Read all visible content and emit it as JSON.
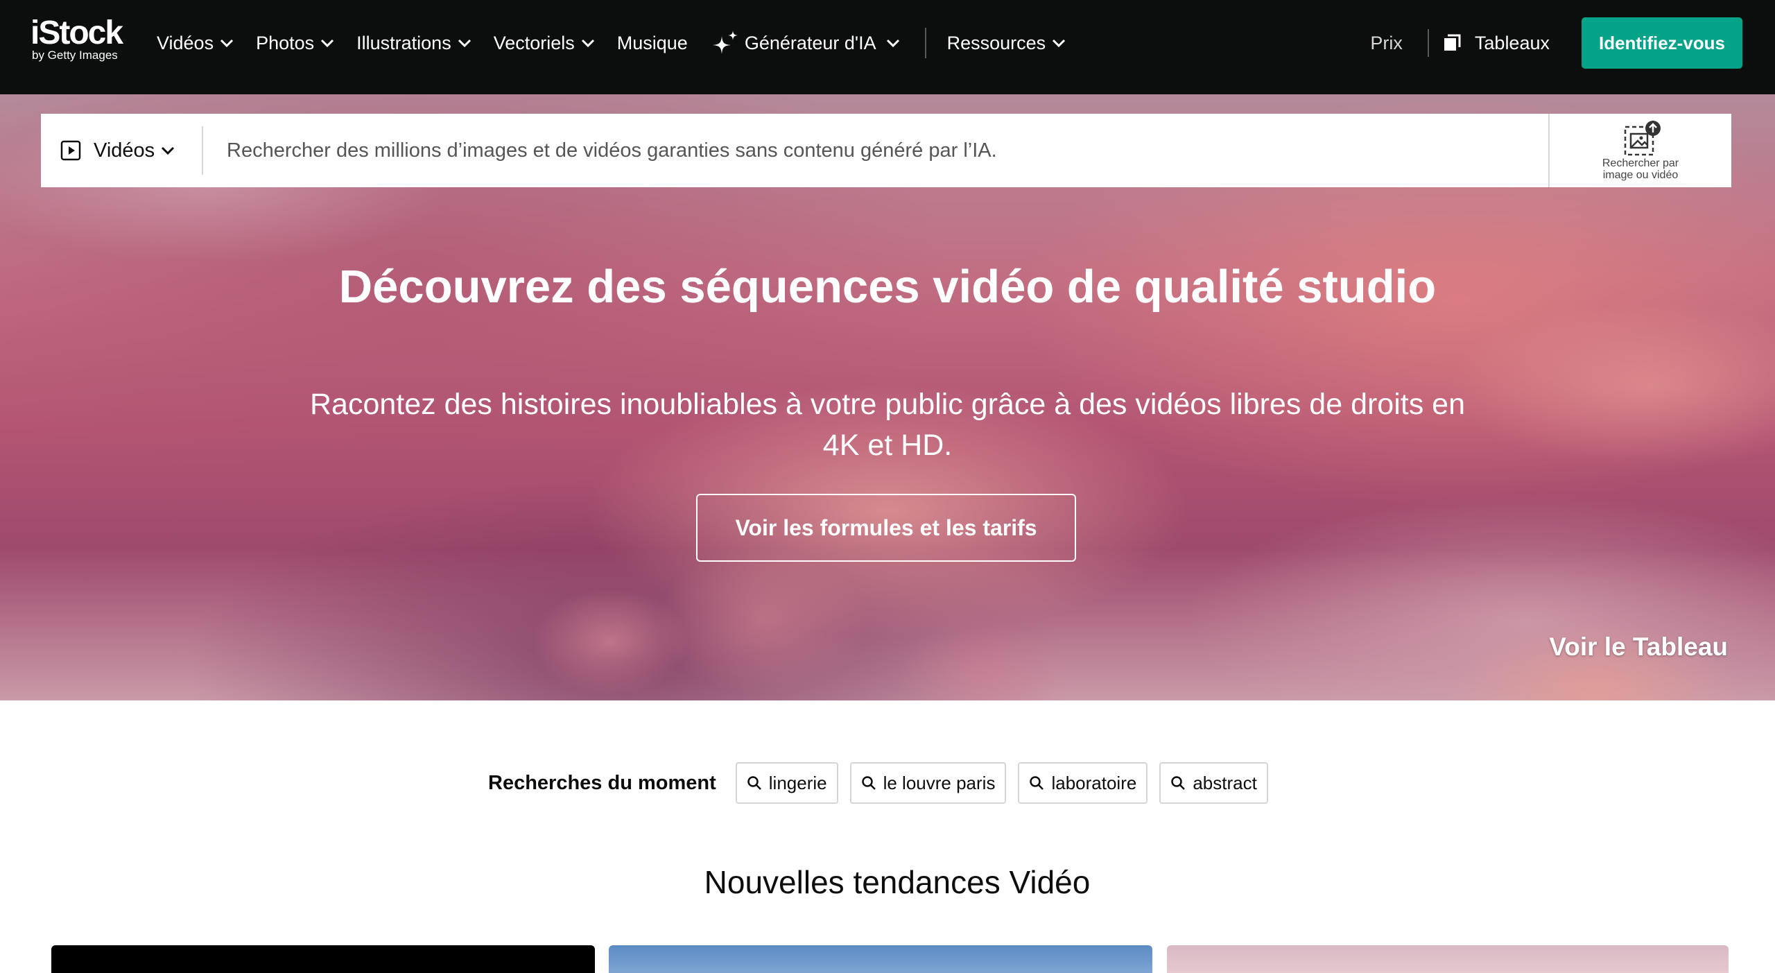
{
  "header": {
    "logo_main": "iStock",
    "logo_sub": "by Getty Images",
    "nav": [
      {
        "label": "Vidéos"
      },
      {
        "label": "Photos"
      },
      {
        "label": "Illustrations"
      },
      {
        "label": "Vectoriels"
      },
      {
        "label": "Musique"
      },
      {
        "label": "Générateur d'IA"
      },
      {
        "label": "Ressources"
      }
    ],
    "price_label": "Prix",
    "boards_label": "Tableaux",
    "signin_label": "Identifiez-vous"
  },
  "search": {
    "type_label": "Vidéos",
    "placeholder": "Rechercher des millions d’images et de vidéos garanties sans contenu généré par l’IA.",
    "visual_search_label": "Rechercher par image ou vidéo"
  },
  "hero": {
    "title": "Découvrez des séquences vidéo de qualité studio",
    "subtitle": "Racontez des histoires inoubliables à votre public grâce à des vidéos libres de droits en 4K et HD.",
    "cta_label": "Voir les formules et les tarifs",
    "board_link": "Voir le Tableau"
  },
  "trending": {
    "label": "Recherches du moment",
    "chips": [
      "lingerie",
      "le louvre paris",
      "laboratoire",
      "abstract"
    ]
  },
  "section": {
    "title": "Nouvelles tendances Vidéo"
  },
  "colors": {
    "nav_bg": "#0c0d0d",
    "accent": "#02a388"
  }
}
